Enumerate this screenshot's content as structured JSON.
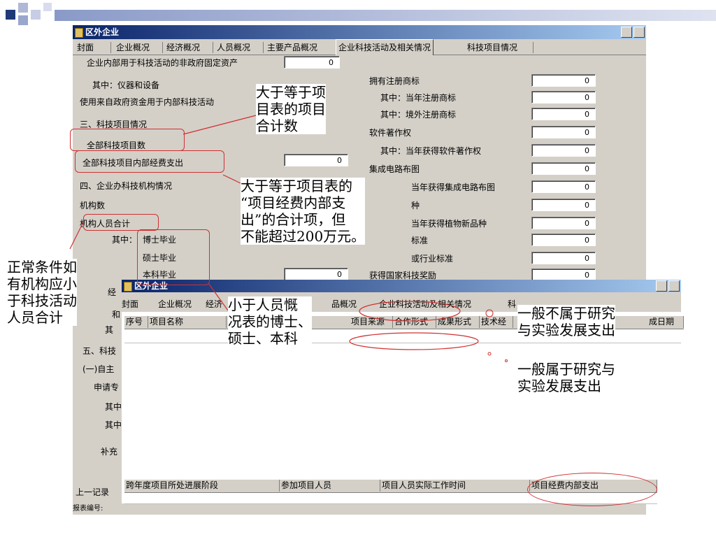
{
  "window": {
    "title": "区外企业",
    "tabs": [
      "封面",
      "企业概况",
      "经济概况",
      "人员概况",
      "主要产品概况",
      "企业科技活动及相关情况",
      "科技项目情况"
    ]
  },
  "left_rows": [
    {
      "label": "企业内部用于科技活动的非政府固定资产",
      "value": "0"
    },
    {
      "label": "其中：仪器和设备",
      "value": ""
    },
    {
      "label": "使用来自政府资金用于内部科技活动",
      "value": ""
    },
    {
      "label": "三、科技项目情况",
      "value": ""
    },
    {
      "label": "全部科技项目数",
      "value": ""
    },
    {
      "label": "全部科技项目内部经费支出",
      "value": "0"
    },
    {
      "label": "四、企业办科技机构情况",
      "value": ""
    },
    {
      "label": "机构数",
      "value": ""
    },
    {
      "label": "机构人员合计",
      "value": ""
    },
    {
      "label": "其中：",
      "value": ""
    },
    {
      "label": "博士毕业",
      "value": ""
    },
    {
      "label": "硕士毕业",
      "value": ""
    },
    {
      "label": "本科毕业",
      "value": "0"
    }
  ],
  "right_rows": [
    {
      "label": "拥有注册商标",
      "value": "0"
    },
    {
      "label": "其中：当年注册商标",
      "value": "0"
    },
    {
      "label": "其中：境外注册商标",
      "value": "0"
    },
    {
      "label": "软件著作权",
      "value": "0"
    },
    {
      "label": "其中：当年获得软件著作权",
      "value": "0"
    },
    {
      "label": "集成电路布图",
      "value": "0"
    },
    {
      "label": "当年获得集成电路布图",
      "value": "0"
    },
    {
      "label": "种",
      "value": "0"
    },
    {
      "label": "当年获得植物新品种",
      "value": "0"
    },
    {
      "label": "标准",
      "value": "0"
    },
    {
      "label": "或行业标准",
      "value": "0"
    },
    {
      "label": "获得国家科技奖励",
      "value": "0"
    }
  ],
  "lower_left_labels": [
    "经",
    "和",
    "其",
    "五、科技",
    "(一)自主",
    "申请专",
    "其中",
    "其中",
    "补充"
  ],
  "footer": {
    "prev_record": "上一记录",
    "report_no": "报表编号:"
  },
  "second_window": {
    "title": "区外企业",
    "tabs": [
      "封面",
      "企业概况",
      "经济",
      "品概况",
      "企业科技活动及相关情况",
      "科"
    ],
    "columns": [
      "序号",
      "项目名称",
      "项目来源",
      "合作形式",
      "成果形式",
      "技术经",
      "成日期"
    ],
    "bottom_columns": [
      "跨年度项目所处进展阶段",
      "参加项目人员",
      "项目人员实际工作时间",
      "项目经费内部支出"
    ]
  },
  "callouts": {
    "c1": [
      "大于等于项",
      "目表的项目",
      "合计数"
    ],
    "c2": [
      "大于等于项目表的",
      "“项目经费内部支",
      "出”的合计项，但",
      "不能超过200万元。"
    ],
    "c3": [
      "正常条件如",
      "有机构应小",
      "于科技活动",
      "人员合计"
    ],
    "c4": [
      "小于人员慨",
      "况表的博士、",
      "硕士、本科"
    ],
    "c5": [
      "一般不属于研究",
      "与实验发展支出"
    ],
    "c6": [
      "一般属于研究与",
      "实验发展支出"
    ]
  },
  "colors": {
    "titlebar": "#0a246a",
    "annotation": "#d03030",
    "window_bg": "#d4d0c8"
  }
}
